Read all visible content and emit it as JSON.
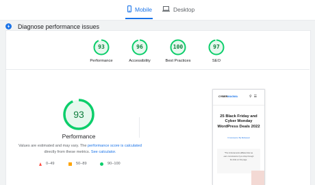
{
  "tabs": {
    "mobile": {
      "label": "Mobile",
      "icon": "smartphone-icon"
    },
    "desktop": {
      "label": "Desktop",
      "icon": "laptop-icon"
    },
    "active": "mobile"
  },
  "diagnose": {
    "label": "Diagnose performance issues",
    "icon": "lightning-icon"
  },
  "categories": [
    {
      "label": "Performance",
      "score": "93"
    },
    {
      "label": "Accessibility",
      "score": "96"
    },
    {
      "label": "Best Practices",
      "score": "100"
    },
    {
      "label": "SEO",
      "score": "97"
    }
  ],
  "main_score": {
    "score": "93",
    "label": "Performance"
  },
  "note": {
    "text1": "Values are estimated and may vary. The",
    "link1": "performance score is calculated",
    "text2": "directly from these metrics.",
    "link2": "See calculator."
  },
  "legend": [
    {
      "range": "0–49",
      "shape": "triangle",
      "color": "#ff4e42"
    },
    {
      "range": "50–89",
      "shape": "square",
      "color": "#ffa400"
    },
    {
      "range": "90–100",
      "shape": "circle",
      "color": "#0cce6b"
    }
  ],
  "preview": {
    "logo_main": "CYBER",
    "logo_accent": "MAGMA",
    "icons": "search-icon menu-icon",
    "title": "25 Black Friday and Cyber Monday WordPress Deals 2022",
    "meta": "6 Comments / By Mohamed",
    "body": "*The Imbursements affiliate links we earn commissions if you shop through the links on this page."
  },
  "colors": {
    "accent": "#1a73e8",
    "pass": "#0cce6b",
    "pass_text": "#0c7d3b"
  }
}
